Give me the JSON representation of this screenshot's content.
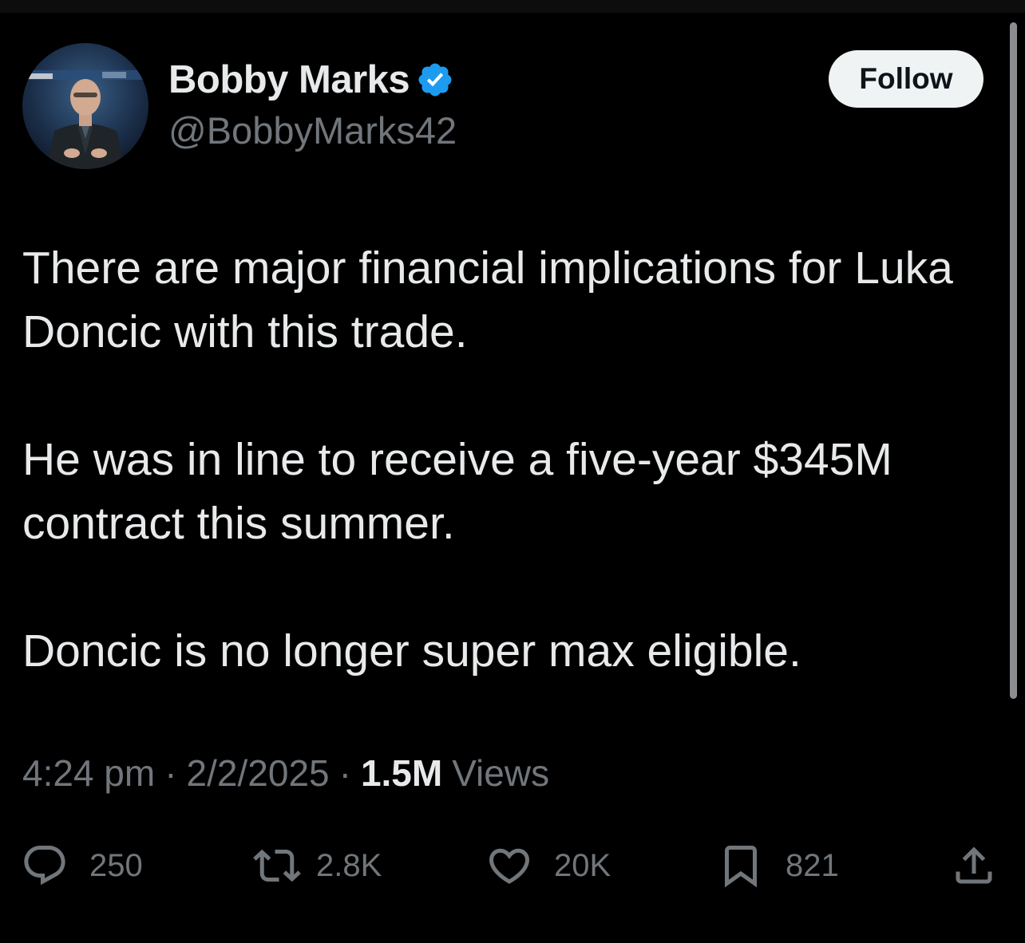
{
  "user": {
    "display_name": "Bobby Marks",
    "handle": "@BobbyMarks42",
    "verified": true,
    "verified_color": "#1d9bf0"
  },
  "follow_button": {
    "label": "Follow"
  },
  "tweet": {
    "paragraphs": [
      "There are major financial implications for Luka Doncic with this trade.",
      "He was in line to receive a five-year $345M contract this summer.",
      "Doncic is no longer super max eligible."
    ]
  },
  "meta": {
    "time": "4:24 pm",
    "separator": "·",
    "date": "2/2/2025",
    "views_count": "1.5M",
    "views_label": "Views"
  },
  "actions": {
    "replies": {
      "icon": "reply-icon",
      "count": "250"
    },
    "reposts": {
      "icon": "repost-icon",
      "count": "2.8K"
    },
    "likes": {
      "icon": "heart-icon",
      "count": "20K"
    },
    "bookmarks": {
      "icon": "bookmark-icon",
      "count": "821"
    },
    "share": {
      "icon": "share-icon"
    }
  },
  "colors": {
    "background": "#000000",
    "text_primary": "#e7e9ea",
    "text_secondary": "#71767b",
    "follow_bg": "#eff3f4"
  }
}
